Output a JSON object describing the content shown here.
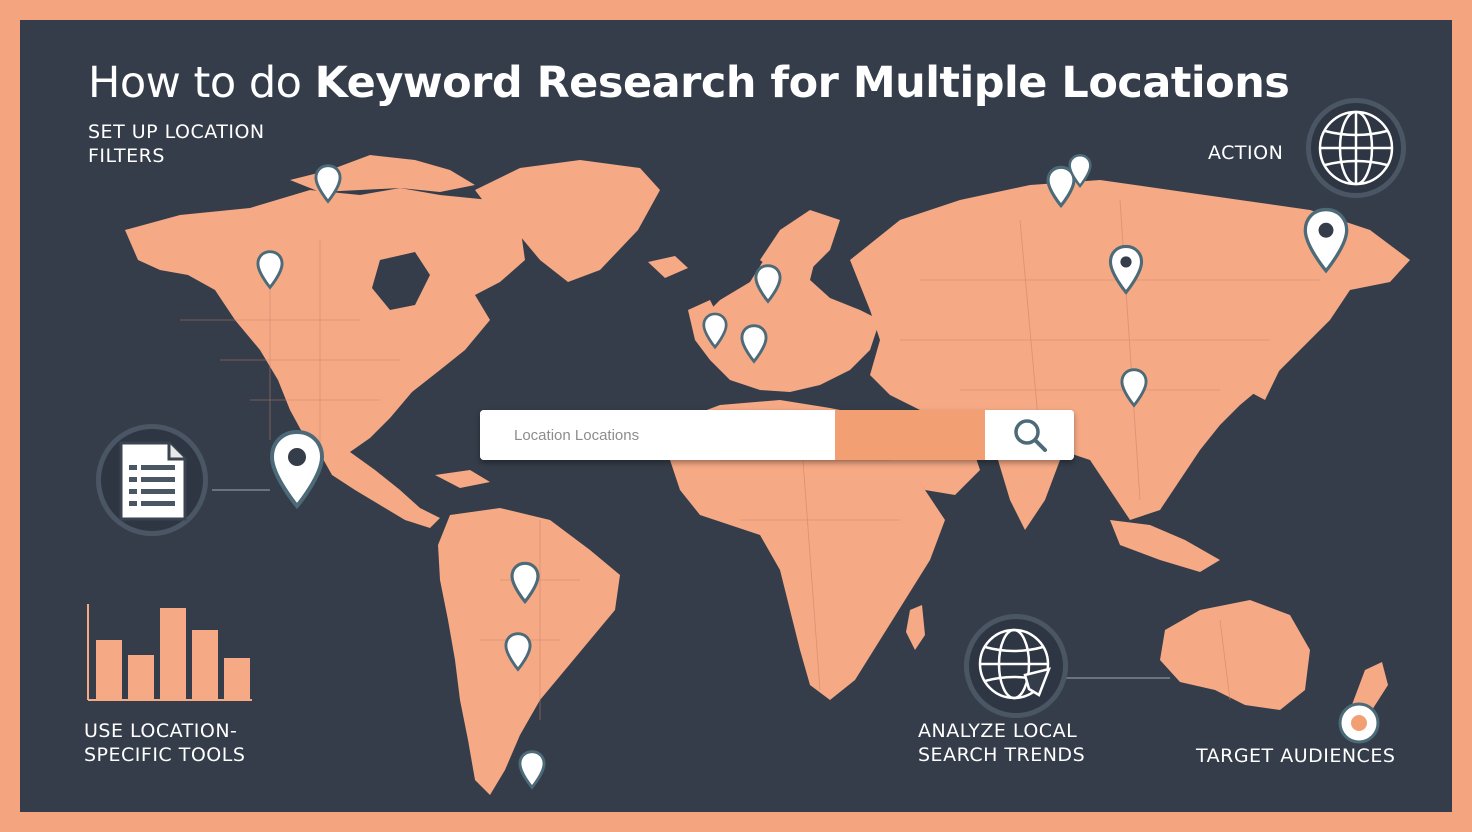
{
  "title": {
    "prefix": "How to do",
    "main": "Keyword Research for Multiple Locations"
  },
  "steps": {
    "filters": [
      "SET UP LOCATION",
      "FILTERS"
    ],
    "action": "ACTION",
    "tools": [
      "USE LOCATION-",
      "SPECIFIC TOOLS"
    ],
    "trends": [
      "ANALYZE LOCAL",
      "SEARCH TRENDS"
    ],
    "audiences": "TARGET AUDIENCES"
  },
  "search": {
    "placeholder": "Location Locations"
  },
  "icons": {
    "search": "magnifier-icon",
    "document": "document-icon",
    "globe": "globe-icon",
    "pin": "map-pin-icon",
    "bars": "bar-chart-icon"
  },
  "colors": {
    "background": "#353d4a",
    "land": "#f5a985",
    "accent": "#f39f74",
    "frame": "#f4a47e",
    "pin_stroke": "#4c6a78"
  }
}
